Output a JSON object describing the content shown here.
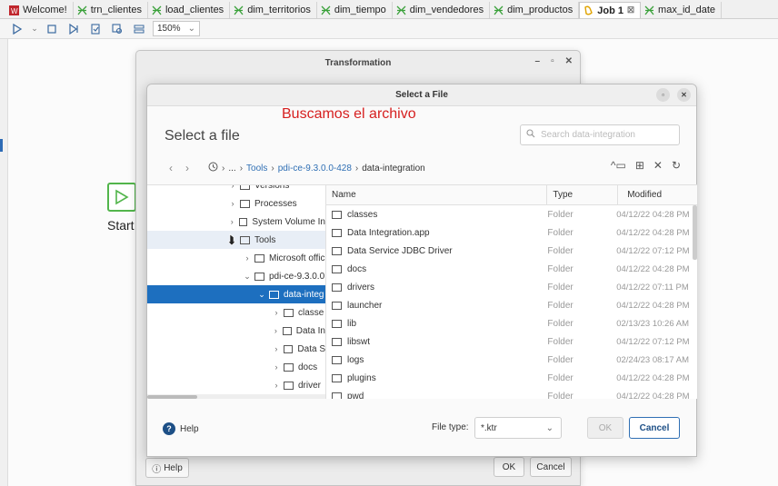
{
  "tabs": [
    {
      "label": "Welcome!",
      "icon": "welcome-icon",
      "color": "#c0262d"
    },
    {
      "label": "trn_clientes",
      "icon": "transformation-icon",
      "color": "#3aa13a"
    },
    {
      "label": "load_clientes",
      "icon": "transformation-icon",
      "color": "#3aa13a"
    },
    {
      "label": "dim_territorios",
      "icon": "transformation-icon",
      "color": "#3aa13a"
    },
    {
      "label": "dim_tiempo",
      "icon": "transformation-icon",
      "color": "#3aa13a"
    },
    {
      "label": "dim_vendedores",
      "icon": "transformation-icon",
      "color": "#3aa13a"
    },
    {
      "label": "dim_productos",
      "icon": "transformation-icon",
      "color": "#3aa13a"
    },
    {
      "label": "Job 1",
      "icon": "job-icon",
      "color": "#e0a300",
      "active": true,
      "close": "☒"
    },
    {
      "label": "max_id_date",
      "icon": "transformation-icon",
      "color": "#3aa13a"
    }
  ],
  "toolbar": {
    "zoom": "150%"
  },
  "canvas": {
    "start_label": "Start"
  },
  "transformation_dialog": {
    "title": "Transformation",
    "help": "Help",
    "ok": "OK",
    "cancel": "Cancel"
  },
  "file_dialog": {
    "title": "Select a File",
    "annotation": "Buscamos el archivo",
    "heading": "Select a file",
    "search_placeholder": "Search data-integration",
    "breadcrumb": {
      "ellipsis": "...",
      "items": [
        "Tools",
        "pdi-ce-9.3.0.0-428",
        "data-integration"
      ]
    },
    "tree": [
      {
        "label": "Versions",
        "indent": 88,
        "chev": "›"
      },
      {
        "label": "Processes",
        "indent": 88,
        "chev": "›"
      },
      {
        "label": "System Volume In",
        "indent": 88,
        "chev": "›"
      },
      {
        "label": "Tools",
        "indent": 88,
        "chev": "⌄"
      },
      {
        "label": "Microsoft offic",
        "indent": 104,
        "chev": "›"
      },
      {
        "label": "pdi-ce-9.3.0.0",
        "indent": 104,
        "chev": "⌄"
      },
      {
        "label": "data-integ",
        "indent": 120,
        "chev": "⌄",
        "selected": true
      },
      {
        "label": "classe",
        "indent": 136,
        "chev": "›"
      },
      {
        "label": "Data In",
        "indent": 136,
        "chev": "›"
      },
      {
        "label": "Data S",
        "indent": 136,
        "chev": "›"
      },
      {
        "label": "docs",
        "indent": 136,
        "chev": "›"
      },
      {
        "label": "driver",
        "indent": 136,
        "chev": "›"
      }
    ],
    "columns": {
      "name": "Name",
      "type": "Type",
      "modified": "Modified"
    },
    "files": [
      {
        "name": "classes",
        "type": "Folder",
        "modified": "04/12/22 04:28 PM"
      },
      {
        "name": "Data Integration.app",
        "type": "Folder",
        "modified": "04/12/22 04:28 PM"
      },
      {
        "name": "Data Service JDBC Driver",
        "type": "Folder",
        "modified": "04/12/22 07:12 PM"
      },
      {
        "name": "docs",
        "type": "Folder",
        "modified": "04/12/22 04:28 PM"
      },
      {
        "name": "drivers",
        "type": "Folder",
        "modified": "04/12/22 07:11 PM"
      },
      {
        "name": "launcher",
        "type": "Folder",
        "modified": "04/12/22 04:28 PM"
      },
      {
        "name": "lib",
        "type": "Folder",
        "modified": "02/13/23 10:26 AM"
      },
      {
        "name": "libswt",
        "type": "Folder",
        "modified": "04/12/22 07:12 PM"
      },
      {
        "name": "logs",
        "type": "Folder",
        "modified": "02/24/23 08:17 AM"
      },
      {
        "name": "plugins",
        "type": "Folder",
        "modified": "04/12/22 04:28 PM"
      },
      {
        "name": "pwd",
        "type": "Folder",
        "modified": "04/12/22 04:28 PM"
      }
    ],
    "footer": {
      "help": "Help",
      "file_type_label": "File type:",
      "file_type_value": "*.ktr",
      "ok": "OK",
      "cancel": "Cancel"
    },
    "colors": {
      "accent": "#1d6fbf",
      "annotation": "#d61f1f",
      "link": "#2f6fb4"
    }
  }
}
